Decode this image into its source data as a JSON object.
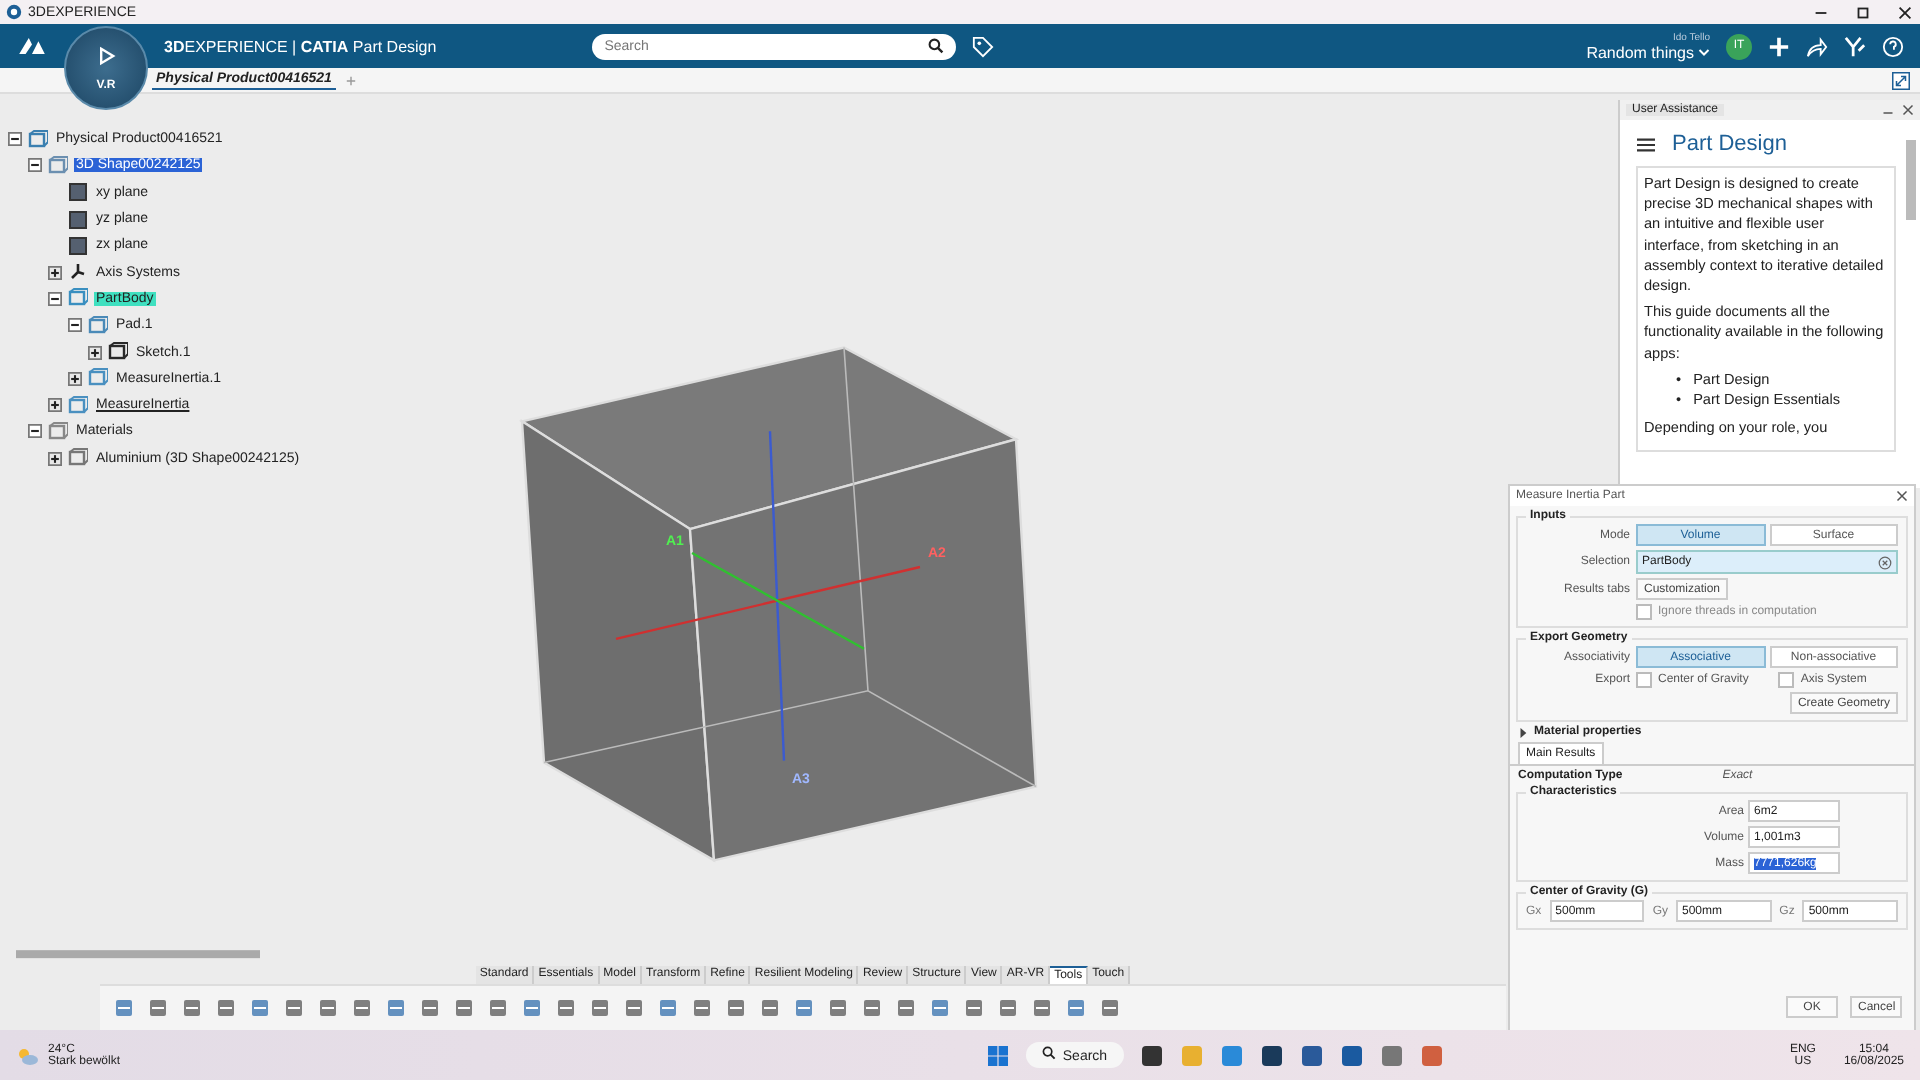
{
  "window": {
    "title": "3DEXPERIENCE"
  },
  "header": {
    "title": "**3D**EXPERIENCE | **CATIA** Part Design",
    "compass_label": "V.R",
    "search": {
      "placeholder": "Search"
    },
    "user": "Ido Tello",
    "space": "Random things",
    "avatar": "IT"
  },
  "doc_tabs": [
    {
      "label": "Physical Product00416521",
      "selected": true
    }
  ],
  "tree": [
    {
      "label": "Physical Product00416521",
      "kind": "product",
      "selected": false,
      "current": false,
      "underlined": false,
      "expanded": true,
      "children": [
        {
          "label": "3D Shape00242125",
          "kind": "shape",
          "selected": true,
          "current": false,
          "underlined": false,
          "expanded": true,
          "children": [
            {
              "label": "xy plane",
              "kind": "plane",
              "selected": false,
              "current": false,
              "underlined": false
            },
            {
              "label": "yz plane",
              "kind": "plane",
              "selected": false,
              "current": false,
              "underlined": false
            },
            {
              "label": "zx plane",
              "kind": "plane",
              "selected": false,
              "current": false,
              "underlined": false
            },
            {
              "label": "Axis Systems",
              "kind": "axis",
              "selected": false,
              "current": false,
              "underlined": false,
              "expanded": false
            },
            {
              "label": "PartBody",
              "kind": "body",
              "selected": false,
              "current": true,
              "underlined": false,
              "expanded": true,
              "children": [
                {
                  "label": "Pad.1",
                  "kind": "pad",
                  "selected": false,
                  "current": false,
                  "underlined": false,
                  "expanded": true,
                  "children": [
                    {
                      "label": "Sketch.1",
                      "kind": "sketch",
                      "selected": false,
                      "current": false,
                      "underlined": false,
                      "expanded": false
                    }
                  ]
                },
                {
                  "label": "MeasureInertia.1",
                  "kind": "measure",
                  "selected": false,
                  "current": false,
                  "underlined": false,
                  "expanded": false
                }
              ]
            },
            {
              "label": "MeasureInertia",
              "kind": "measure",
              "selected": false,
              "current": false,
              "underlined": true,
              "expanded": false
            }
          ]
        },
        {
          "label": "Materials",
          "kind": "folder",
          "selected": false,
          "current": false,
          "underlined": false,
          "expanded": true,
          "children": [
            {
              "label": "Aluminium (3D Shape00242125)",
              "kind": "material",
              "selected": false,
              "current": false,
              "underlined": false,
              "expanded": false
            }
          ]
        }
      ]
    }
  ],
  "axes": [
    {
      "label": "A1"
    },
    {
      "label": "A2"
    },
    {
      "label": "A3"
    }
  ],
  "assistance": {
    "title": "User Assistance",
    "heading": "Part Design",
    "paragraphs": [
      "Part Design is designed to create precise 3D mechanical shapes with an intuitive and flexible user interface, from sketching in an assembly context to iterative detailed design.",
      "This guide documents all the functionality available in the following apps:"
    ],
    "bullets": [
      {
        "marker": "•",
        "text": "Part Design"
      },
      {
        "marker": "•",
        "text": "Part Design Essentials"
      }
    ],
    "trailing": "Depending on your role, you"
  },
  "dialog": {
    "title": "Measure Inertia Part",
    "inputs": {
      "title": "Inputs",
      "mode_label": "Mode",
      "modes": [
        {
          "label": "Volume",
          "selected": true
        },
        {
          "label": "Surface",
          "selected": false
        }
      ],
      "selection_label": "Selection",
      "selection": "PartBody",
      "results_label": "Results tabs",
      "results_button": "Customization",
      "ignore_threads": {
        "label": "Ignore threads in computation",
        "checked": false
      }
    },
    "export": {
      "title": "Export Geometry",
      "assoc_label": "Associativity",
      "assoc": [
        {
          "label": "Associative",
          "selected": true
        },
        {
          "label": "Non-associative",
          "selected": false
        }
      ],
      "export_label": "Export",
      "options": [
        {
          "label": "Center of Gravity",
          "checked": false
        },
        {
          "label": "Axis System",
          "checked": false
        }
      ],
      "create": "Create Geometry"
    },
    "material": {
      "label": "Material properties",
      "expanded": false
    },
    "results_tabs": [
      {
        "label": "Main Results",
        "selected": true
      }
    ],
    "computation_label": "Computation Type",
    "computation": "Exact",
    "characteristics": {
      "title": "Characteristics",
      "fields": [
        {
          "label": "Area",
          "value": "6m2",
          "selected": false
        },
        {
          "label": "Volume",
          "value": "1,001m3",
          "selected": false
        },
        {
          "label": "Mass",
          "value": "7771,626kg",
          "selected": true
        }
      ]
    },
    "cog": {
      "title": "Center of Gravity (G)",
      "fields": [
        {
          "label": "Gx",
          "value": "500mm"
        },
        {
          "label": "Gy",
          "value": "500mm"
        },
        {
          "label": "Gz",
          "value": "500mm"
        }
      ]
    },
    "buttons": [
      "OK",
      "Cancel"
    ]
  },
  "toolbar": {
    "tabs": [
      {
        "label": "Standard",
        "selected": false
      },
      {
        "label": "Essentials",
        "selected": false
      },
      {
        "label": "Model",
        "selected": false
      },
      {
        "label": "Transform",
        "selected": false
      },
      {
        "label": "Refine",
        "selected": false
      },
      {
        "label": "Resilient Modeling",
        "selected": false
      },
      {
        "label": "Review",
        "selected": false
      },
      {
        "label": "Structure",
        "selected": false
      },
      {
        "label": "View",
        "selected": false
      },
      {
        "label": "AR-VR",
        "selected": false
      },
      {
        "label": "Tools",
        "selected": true
      },
      {
        "label": "Touch",
        "selected": false
      }
    ]
  },
  "taskbar": {
    "temperature": "24°C",
    "weather": "Stark bewölkt",
    "search": "Search",
    "lang": "ENG",
    "region": "US",
    "time": "15:04",
    "date": "16/08/2025"
  }
}
